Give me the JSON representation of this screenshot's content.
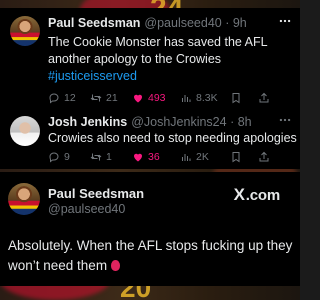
{
  "posts": [
    {
      "name": "Paul Seedsman",
      "handle": "@paulseed40",
      "sep": " · ",
      "time": "9h",
      "text_line1": "The Cookie Monster has saved the AFL",
      "text_line2": "another apology to the Crowies",
      "hashtag": "#justiceisserved",
      "replies": "12",
      "reposts": "21",
      "likes": "493",
      "views": "8.3K"
    },
    {
      "name": "Josh Jenkins",
      "handle": "@JoshJenkins24",
      "sep": " · ",
      "time": "8h",
      "text": "Crowies also need to stop needing apologies",
      "replies": "9",
      "reposts": "1",
      "likes": "36",
      "views": "2K"
    },
    {
      "name": "Paul Seedsman",
      "handle": "@paulseed40",
      "text_line1": "Absolutely. When the AFL stops fucking up they",
      "text_line2": "won’t need them"
    }
  ],
  "brand": "X.com",
  "colors": {
    "like_active": "#f91880",
    "link": "#1d9bf0",
    "muted": "#71767b"
  },
  "icons": [
    "reply-icon",
    "repost-icon",
    "heart-icon",
    "views-icon",
    "bookmark-icon",
    "share-icon",
    "more-icon",
    "x-logo-icon",
    "balloon-emoji"
  ]
}
